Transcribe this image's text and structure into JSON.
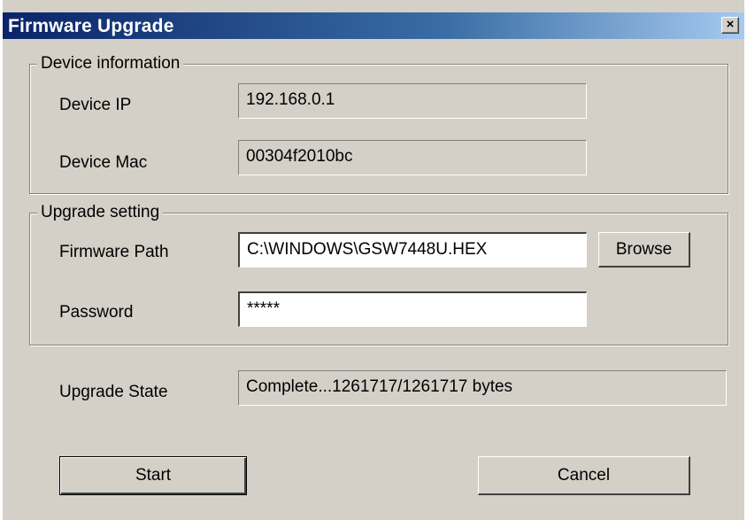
{
  "window": {
    "title": "Firmware Upgrade",
    "close_symbol": "×"
  },
  "device_info": {
    "legend": "Device information",
    "ip_label": "Device IP",
    "ip_value": "192.168.0.1",
    "mac_label": "Device Mac",
    "mac_value": "00304f2010bc"
  },
  "upgrade_setting": {
    "legend": "Upgrade setting",
    "path_label": "Firmware Path",
    "path_value": "C:\\WINDOWS\\GSW7448U.HEX",
    "browse_label": "Browse",
    "password_label": "Password",
    "password_value": "*****"
  },
  "state": {
    "label": "Upgrade State",
    "value": "Complete...1261717/1261717 bytes"
  },
  "actions": {
    "start_label": "Start",
    "cancel_label": "Cancel"
  },
  "colors": {
    "titlebar_start": "#0a246a",
    "titlebar_end": "#a6caf0",
    "dialog_bg": "#d4d0c8"
  }
}
